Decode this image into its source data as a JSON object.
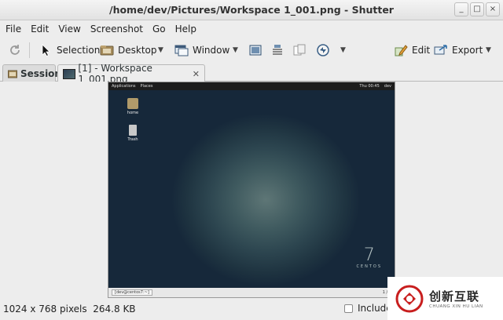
{
  "window": {
    "title": "/home/dev/Pictures/Workspace 1_001.png - Shutter",
    "controls": [
      "_",
      "□",
      "×"
    ]
  },
  "menu": [
    "File",
    "Edit",
    "View",
    "Screenshot",
    "Go",
    "Help"
  ],
  "toolbar": {
    "selection": "Selection",
    "desktop": "Desktop",
    "window": "Window",
    "edit": "Edit",
    "export": "Export"
  },
  "tabs": {
    "session": "Session",
    "active": "[1] - Workspace 1_001.png",
    "close": "✕"
  },
  "screenshot": {
    "panel_left": [
      "Applications",
      "Places"
    ],
    "panel_right": [
      "Thu 00:45",
      "dev"
    ],
    "icons": [
      {
        "label": "home"
      },
      {
        "label": "Trash"
      }
    ],
    "logo_number": "7",
    "logo_text": "CENTOS",
    "task_label": "[dev@centos7:~]",
    "pager": "1 / 4"
  },
  "status": {
    "info": "1024 x 768 pixels  264.8 KB",
    "include": "Include"
  },
  "watermark": {
    "cn": "创新互联",
    "en": "CHUANG XIN HU LIAN"
  },
  "colors": {
    "accent_blue": "#2f6fa8",
    "watermark_red": "#c81e1e"
  }
}
